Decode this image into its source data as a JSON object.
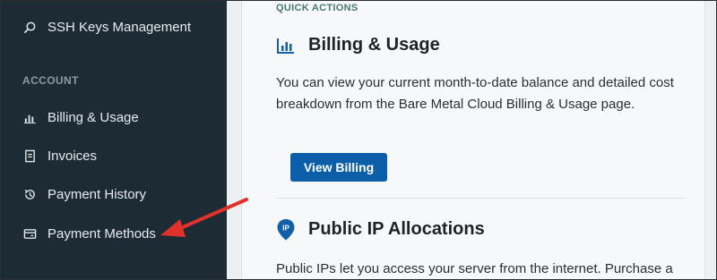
{
  "sidebar": {
    "top_item": {
      "label": "SSH Keys Management",
      "icon": "search-icon"
    },
    "section": "ACCOUNT",
    "items": [
      {
        "label": "Billing & Usage",
        "icon": "bar-chart-icon"
      },
      {
        "label": "Invoices",
        "icon": "invoice-icon"
      },
      {
        "label": "Payment History",
        "icon": "history-icon"
      },
      {
        "label": "Payment Methods",
        "icon": "credit-card-icon"
      }
    ]
  },
  "main": {
    "quick_actions_label": "QUICK ACTIONS",
    "billing": {
      "title": "Billing & Usage",
      "icon": "bar-chart-icon",
      "description": "You can view your current month-to-date balance and detailed cost breakdown from the Bare Metal Cloud Billing & Usage page.",
      "button_label": "View Billing"
    },
    "public_ip": {
      "title": "Public IP Allocations",
      "icon": "ip-pin-icon",
      "icon_text": "IP",
      "description": "Public IPs let you access your server from the internet. Purchase a"
    }
  },
  "annotation": {
    "type": "arrow",
    "target": "Payment Methods",
    "color": "#e0312b"
  },
  "colors": {
    "sidebar_bg": "#1d2b35",
    "accent": "#0d5ea8",
    "arrow": "#e0312b"
  }
}
